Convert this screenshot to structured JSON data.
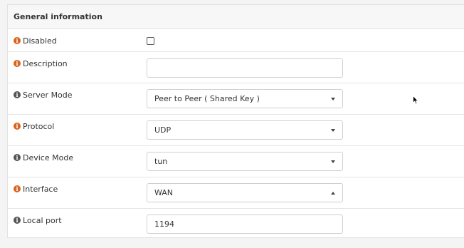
{
  "section": {
    "title": "General information"
  },
  "fields": {
    "disabled": {
      "label": "Disabled",
      "checked": false,
      "icon": "info-icon",
      "icon_color": "#d9641e"
    },
    "description": {
      "label": "Description",
      "value": "",
      "icon": "info-icon",
      "icon_color": "#d9641e"
    },
    "server_mode": {
      "label": "Server Mode",
      "value": "Peer to Peer ( Shared Key )",
      "icon": "info-icon",
      "icon_color": "#555555"
    },
    "protocol": {
      "label": "Protocol",
      "value": "UDP",
      "icon": "info-icon",
      "icon_color": "#d9641e"
    },
    "device_mode": {
      "label": "Device Mode",
      "value": "tun",
      "icon": "info-icon",
      "icon_color": "#555555"
    },
    "interface": {
      "label": "Interface",
      "value": "WAN",
      "icon": "info-icon",
      "icon_color": "#d9641e",
      "open": true
    },
    "local_port": {
      "label": "Local port",
      "value": "1194",
      "icon": "info-icon",
      "icon_color": "#555555"
    }
  },
  "icons": {
    "info_glyph": "i"
  }
}
